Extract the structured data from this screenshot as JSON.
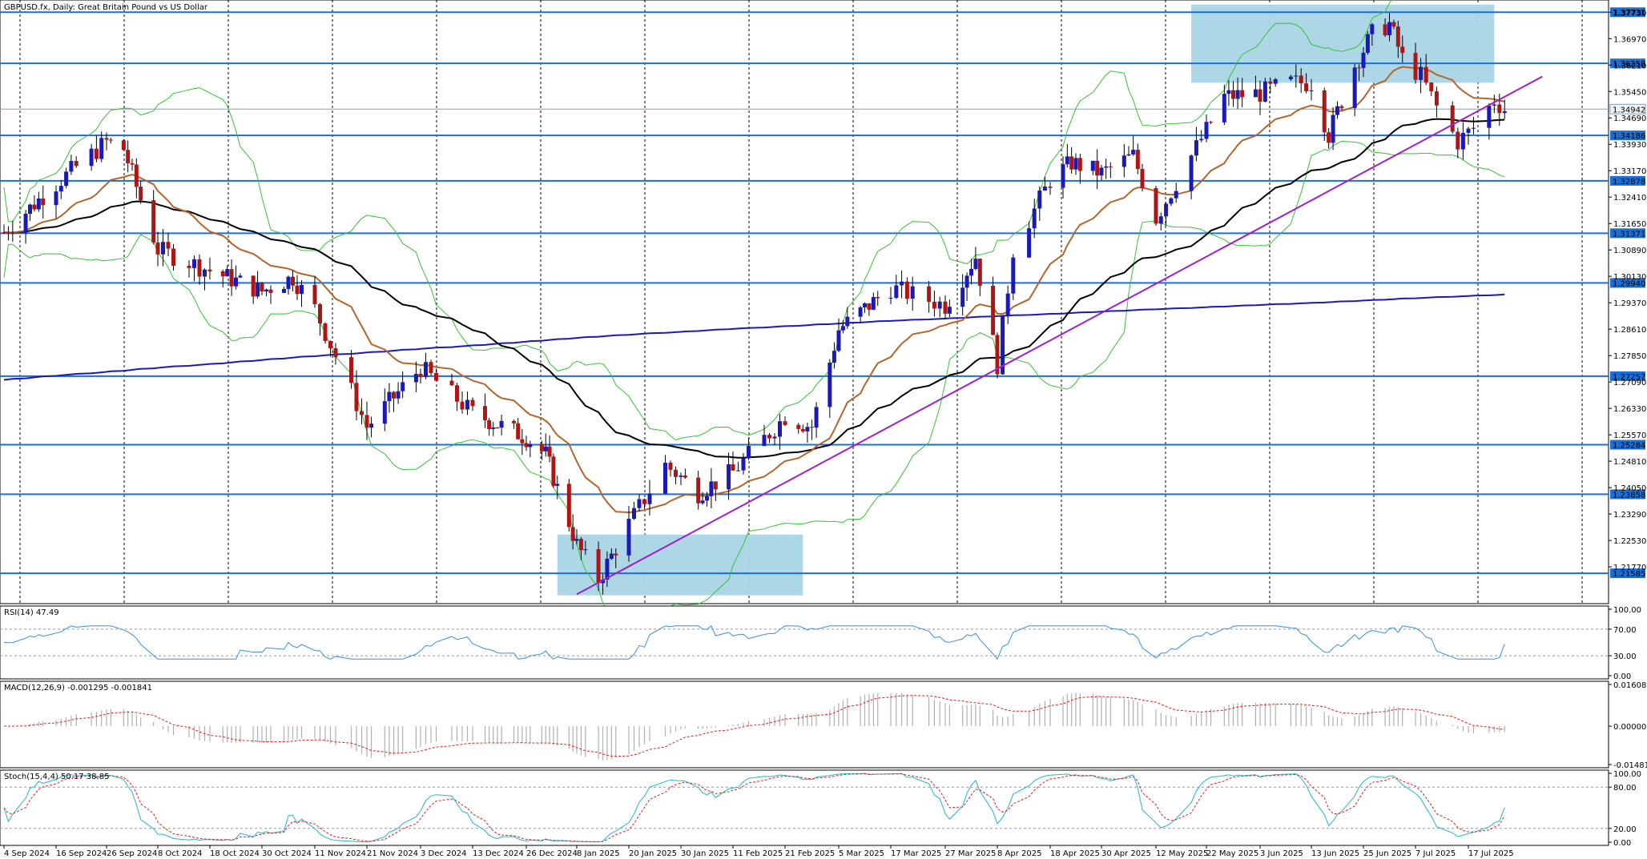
{
  "window": {
    "title": "GBPUSD.fx, Daily:  Great Britain Pound vs US Dollar"
  },
  "colors": {
    "bull": "#1a1ab8",
    "bear": "#b01515",
    "level": "#1a6fd6",
    "zone": "#a9d4e5",
    "trend": "#a020c8",
    "ema_fast": "#b5652a",
    "ema_mid": "#000000",
    "ema_slow": "#1a1ab8",
    "bollinger": "#35c235",
    "rsi": "#3a8fd6",
    "macd_signal": "#e02020",
    "macd_hist": "#b0b0b0",
    "stoch_main": "#21b6c9",
    "stoch_signal": "#e02020"
  },
  "icons": {
    "price_tag_marker": "rectangle"
  },
  "chart_data": [
    {
      "type": "candlestick",
      "panel": "price",
      "symbol": "GBPUSD.fx",
      "timeframe": "Daily",
      "title": "GBPUSD.fx, Daily:  Great Britain Pound vs US Dollar",
      "ylim": [
        1.2085,
        1.3799
      ],
      "y_ticks": [
        "1.37730",
        "1.36970",
        "1.36210",
        "1.35450",
        "1.34690",
        "1.33930",
        "1.33170",
        "1.32410",
        "1.31650",
        "1.30890",
        "1.30130",
        "1.29370",
        "1.28610",
        "1.27850",
        "1.27090",
        "1.26330",
        "1.25570",
        "1.24810",
        "1.24050",
        "1.23290",
        "1.22530",
        "1.21770"
      ],
      "x_tick_labels": [
        "4 Sep 2024",
        "16 Sep 2024",
        "26 Sep 2024",
        "8 Oct 2024",
        "18 Oct 2024",
        "30 Oct 2024",
        "11 Nov 2024",
        "21 Nov 2024",
        "3 Dec 2024",
        "13 Dec 2024",
        "26 Dec 2024",
        "8 Jan 2025",
        "20 Jan 2025",
        "30 Jan 2025",
        "11 Feb 2025",
        "21 Feb 2025",
        "5 Mar 2025",
        "17 Mar 2025",
        "27 Mar 2025",
        "8 Apr 2025",
        "18 Apr 2025",
        "30 Apr 2025",
        "12 May 2025",
        "22 May 2025",
        "3 Jun 2025",
        "13 Jun 2025",
        "25 Jun 2025",
        "7 Jul 2025",
        "17 Jul 2025"
      ],
      "horizontal_levels": [
        "1.37731",
        "1.36258",
        "1.34186",
        "1.32878",
        "1.31371",
        "1.29940",
        "1.27257",
        "1.25284",
        "1.23858",
        "1.21585"
      ],
      "current_price": "1.34942",
      "grid": true,
      "zones": [
        {
          "from_date": "3 Jan 2025",
          "to_date": "25 Feb 2025",
          "high": 1.227,
          "low": 1.2095
        },
        {
          "from_date": "19 May 2025",
          "to_date": "22 Jul 2025",
          "high": 1.3795,
          "low": 1.357
        }
      ],
      "trendline": {
        "from": [
          "8 Jan 2025",
          1.2098
        ],
        "to": [
          "22 Jul 2025",
          1.3548
        ]
      },
      "indicators": [
        "EMA fast (brown)",
        "EMA mid (black)",
        "EMA slow (blue)",
        "Bollinger Bands (green)"
      ]
    },
    {
      "type": "line",
      "panel": "rsi",
      "label": "RSI(14) 47.49",
      "ylim": [
        0,
        100
      ],
      "y_ticks": [
        "100.00",
        "70.00",
        "30.00",
        "0.00"
      ],
      "levels": [
        70,
        30
      ],
      "current": 47.49
    },
    {
      "type": "bar",
      "panel": "macd",
      "label": "MACD(12,26,9) -0.001295 -0.001841",
      "ylim": [
        -0.014818,
        0.016085
      ],
      "y_ticks": [
        "0.016085",
        "0.000000",
        "-0.014818"
      ],
      "main": -0.001295,
      "signal": -0.001841
    },
    {
      "type": "line",
      "panel": "stochastic",
      "label": "Stoch(15,4,4) 50.17 38.85",
      "ylim": [
        0,
        100
      ],
      "y_ticks": [
        "100.00",
        "80.00",
        "20.00",
        "0.00"
      ],
      "levels": [
        80,
        20
      ],
      "main": 50.17,
      "signal": 38.85
    }
  ]
}
